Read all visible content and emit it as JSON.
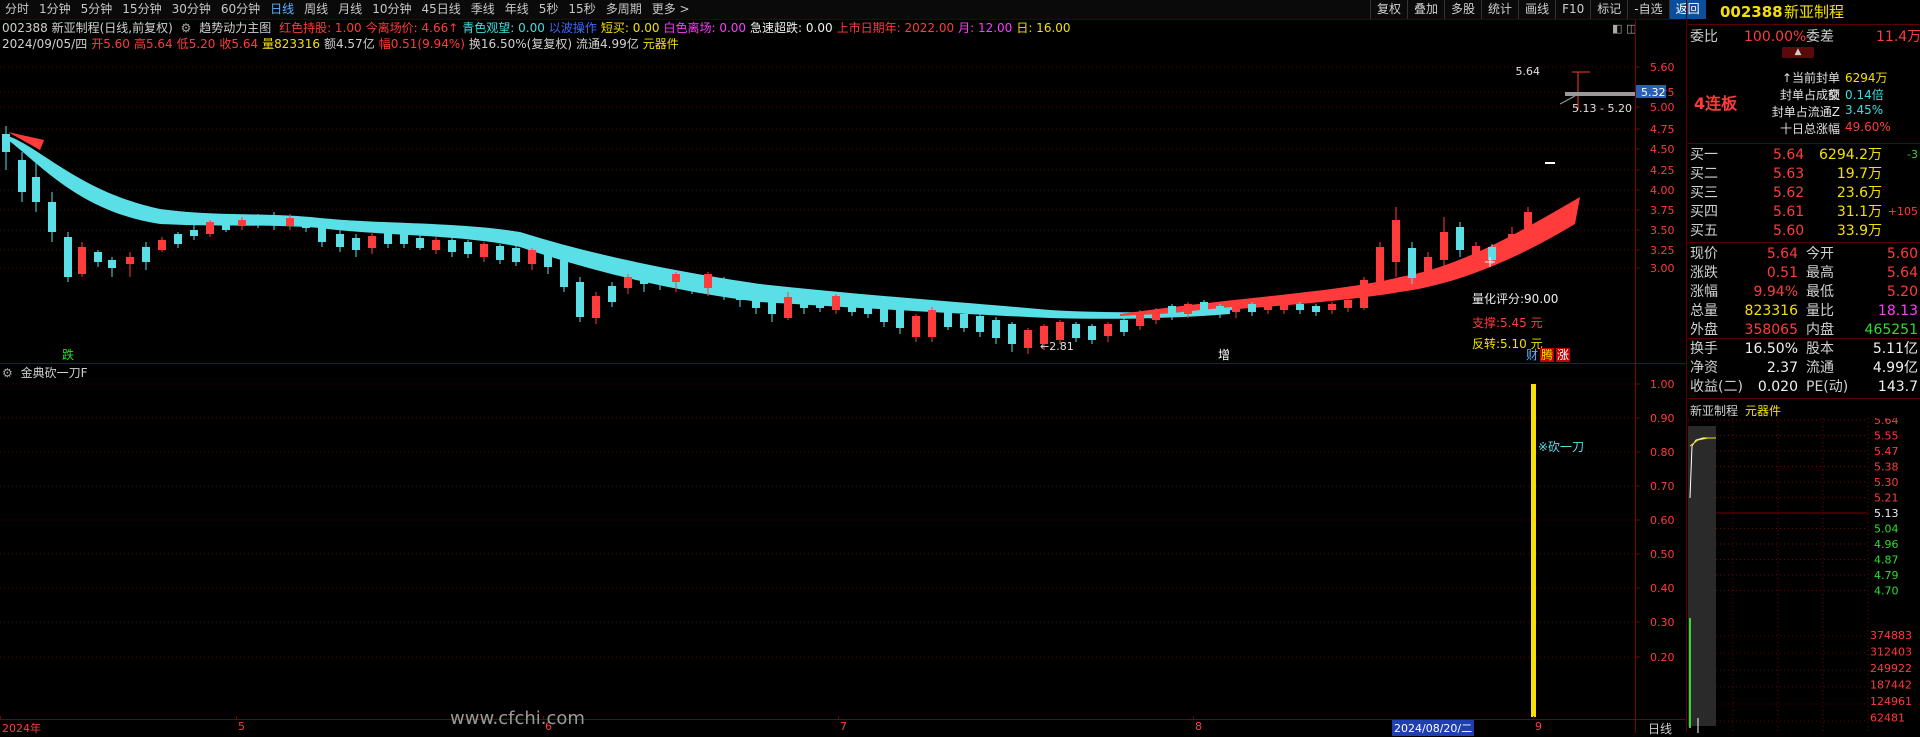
{
  "period_bar": {
    "items": [
      "分时",
      "1分钟",
      "5分钟",
      "15分钟",
      "30分钟",
      "60分钟",
      "日线",
      "周线",
      "月线",
      "10分钟",
      "45日线",
      "季线",
      "年线",
      "5秒",
      "15秒",
      "多周期",
      "更多 >"
    ],
    "active_index": 6
  },
  "toolbar": {
    "items": [
      "复权",
      "叠加",
      "多股",
      "统计",
      "画线",
      "F10",
      "标记",
      "-自选",
      "返回"
    ]
  },
  "header": {
    "code_line": "002388 新亚制程(日线,前复权)",
    "indicator_name": "趋势动力主图",
    "params": [
      {
        "text": "红色持股: 1.00",
        "color": "#ff3b3b"
      },
      {
        "text": "今离场价: 4.66↑",
        "color": "#ff3b3b"
      },
      {
        "text": "青色观望: 0.00",
        "color": "#3ce0e0"
      },
      {
        "text": "以波操作",
        "color": "#3b6bff"
      },
      {
        "text": "短买: 0.00",
        "color": "#f5e000"
      },
      {
        "text": "白色离场: 0.00",
        "color": "#ff3bff"
      },
      {
        "text": "急速超跌: 0.00",
        "color": "#f0f0f0"
      },
      {
        "text": "上市日期年: 2022.00",
        "color": "#ff3b3b"
      },
      {
        "text": "月: 12.00",
        "color": "#ff3bff"
      },
      {
        "text": "日: 16.00",
        "color": "#f5e000"
      }
    ],
    "ohlc_line": [
      {
        "text": "2024/09/05/四",
        "color": "#d0d0d0"
      },
      {
        "text": "开5.60",
        "color": "#ff3b3b"
      },
      {
        "text": "高5.64",
        "color": "#ff3b3b"
      },
      {
        "text": "低5.20",
        "color": "#ff3b3b"
      },
      {
        "text": "收5.64",
        "color": "#ff3b3b"
      },
      {
        "text": "量823316",
        "color": "#f5e000"
      },
      {
        "text": "额4.57亿",
        "color": "#d0d0d0"
      },
      {
        "text": "幅0.51(9.94%)",
        "color": "#ff3b3b"
      },
      {
        "text": "换16.50%(复复权)",
        "color": "#d0d0d0"
      },
      {
        "text": "流通4.99亿",
        "color": "#d0d0d0"
      },
      {
        "text": "元器件",
        "color": "#f5e000"
      }
    ]
  },
  "main_chart": {
    "y_ticks": [
      "5.60",
      "5.25",
      "5.00",
      "4.75",
      "4.50",
      "4.25",
      "4.00",
      "3.75",
      "3.50",
      "3.25",
      "3.00"
    ],
    "price_tag": "5.32",
    "annotations": {
      "top_price": "5.64",
      "range": "5.13 - 5.20",
      "low_price": "←2.81",
      "score": "量化评分:90.00",
      "support": "支撑:5.45 元",
      "reversal": "反转:5.10 元",
      "sig_die": "跌",
      "sig_zeng": "增",
      "sig_cai": "财",
      "sig_sheng": "腾",
      "sig_zhang": "涨"
    }
  },
  "sub_chart": {
    "title": "金典砍一刀F",
    "y_ticks": [
      "1.00",
      "0.90",
      "0.80",
      "0.70",
      "0.60",
      "0.50",
      "0.40",
      "0.30",
      "0.20"
    ],
    "label": "※砍一刀"
  },
  "x_axis": {
    "labels": [
      "2024年",
      "5",
      "6",
      "7",
      "8",
      "9"
    ],
    "cursor_date": "2024/08/20/二"
  },
  "watermark": "www.cfchi.com",
  "right_panel": {
    "code": "002388",
    "name": "新亚制程",
    "weibi_label": "委比",
    "weibi_value": "100.00%",
    "weicha_label": "委差",
    "weicha_value": "11.4万",
    "limit_tag": "4连板",
    "limit_stats": [
      {
        "label": "↑当前封单额",
        "value": "6294万",
        "color": "#f5e000"
      },
      {
        "label": "封单占成交",
        "value": "0.14倍",
        "color": "#3ce0e0"
      },
      {
        "label": "封单占流通Z",
        "value": "3.45%",
        "color": "#3ce0e0"
      },
      {
        "label": "十日总涨幅",
        "value": "49.60%",
        "color": "#ff3b3b"
      }
    ],
    "buy_orders": [
      {
        "label": "买一",
        "price": "5.64",
        "vol": "6294.2万",
        "chg": "-3",
        "chg_color": "#2edd2e"
      },
      {
        "label": "买二",
        "price": "5.63",
        "vol": "19.7万",
        "chg": "",
        "chg_color": "#2edd2e"
      },
      {
        "label": "买三",
        "price": "5.62",
        "vol": "23.6万",
        "chg": "",
        "chg_color": "#2edd2e"
      },
      {
        "label": "买四",
        "price": "5.61",
        "vol": "31.1万",
        "chg": "+105",
        "chg_color": "#ff3b3b"
      },
      {
        "label": "买五",
        "price": "5.60",
        "vol": "33.9万",
        "chg": "",
        "chg_color": "#2edd2e"
      }
    ],
    "quote_rows": [
      [
        {
          "label": "现价",
          "value": "5.64",
          "color": "#ff3b3b"
        },
        {
          "label": "今开",
          "value": "5.60",
          "color": "#ff3b3b"
        }
      ],
      [
        {
          "label": "涨跌",
          "value": "0.51",
          "color": "#ff3b3b"
        },
        {
          "label": "最高",
          "value": "5.64",
          "color": "#ff3b3b"
        }
      ],
      [
        {
          "label": "涨幅",
          "value": "9.94%",
          "color": "#ff3b3b"
        },
        {
          "label": "最低",
          "value": "5.20",
          "color": "#ff3b3b"
        }
      ],
      [
        {
          "label": "总量",
          "value": "823316",
          "color": "#f5e000"
        },
        {
          "label": "量比",
          "value": "18.13",
          "color": "#ff3bff"
        }
      ],
      [
        {
          "label": "外盘",
          "value": "358065",
          "color": "#ff3b3b"
        },
        {
          "label": "内盘",
          "value": "465251",
          "color": "#2edd2e"
        }
      ]
    ],
    "fund_rows": [
      [
        {
          "label": "换手",
          "value": "16.50%",
          "color": "#f0f0f0"
        },
        {
          "label": "股本",
          "value": "5.11亿",
          "color": "#f0f0f0"
        }
      ],
      [
        {
          "label": "净资",
          "value": "2.37",
          "color": "#f0f0f0"
        },
        {
          "label": "流通",
          "value": "4.99亿",
          "color": "#f0f0f0"
        }
      ],
      [
        {
          "label": "收益(二)",
          "value": "0.020",
          "color": "#f0f0f0"
        },
        {
          "label": "PE(动)",
          "value": "143.7",
          "color": "#f0f0f0"
        }
      ]
    ],
    "mini_name": "新亚制程",
    "mini_sector": "元器件",
    "mini_price_ticks": [
      {
        "v": "5.64",
        "color": "#ff3b3b"
      },
      {
        "v": "5.55",
        "color": "#ff3b3b"
      },
      {
        "v": "5.47",
        "color": "#ff3b3b"
      },
      {
        "v": "5.38",
        "color": "#ff3b3b"
      },
      {
        "v": "5.30",
        "color": "#ff3b3b"
      },
      {
        "v": "5.21",
        "color": "#ff3b3b"
      },
      {
        "v": "5.13",
        "color": "#f0f0f0"
      },
      {
        "v": "5.04",
        "color": "#2edd2e"
      },
      {
        "v": "4.96",
        "color": "#2edd2e"
      },
      {
        "v": "4.87",
        "color": "#2edd2e"
      },
      {
        "v": "4.79",
        "color": "#2edd2e"
      },
      {
        "v": "4.70",
        "color": "#2edd2e"
      }
    ],
    "mini_vol_ticks": [
      "374883",
      "312403",
      "249922",
      "187442",
      "124961",
      "62481"
    ],
    "period_label": "日线"
  },
  "colors": {
    "up": "#ff3b3b",
    "down": "#5adfe6",
    "ma_cyan": "#5adfe6",
    "ma_red": "#ff3b3b",
    "grid": "#7a0000",
    "signal_bar": "#f5e000"
  }
}
